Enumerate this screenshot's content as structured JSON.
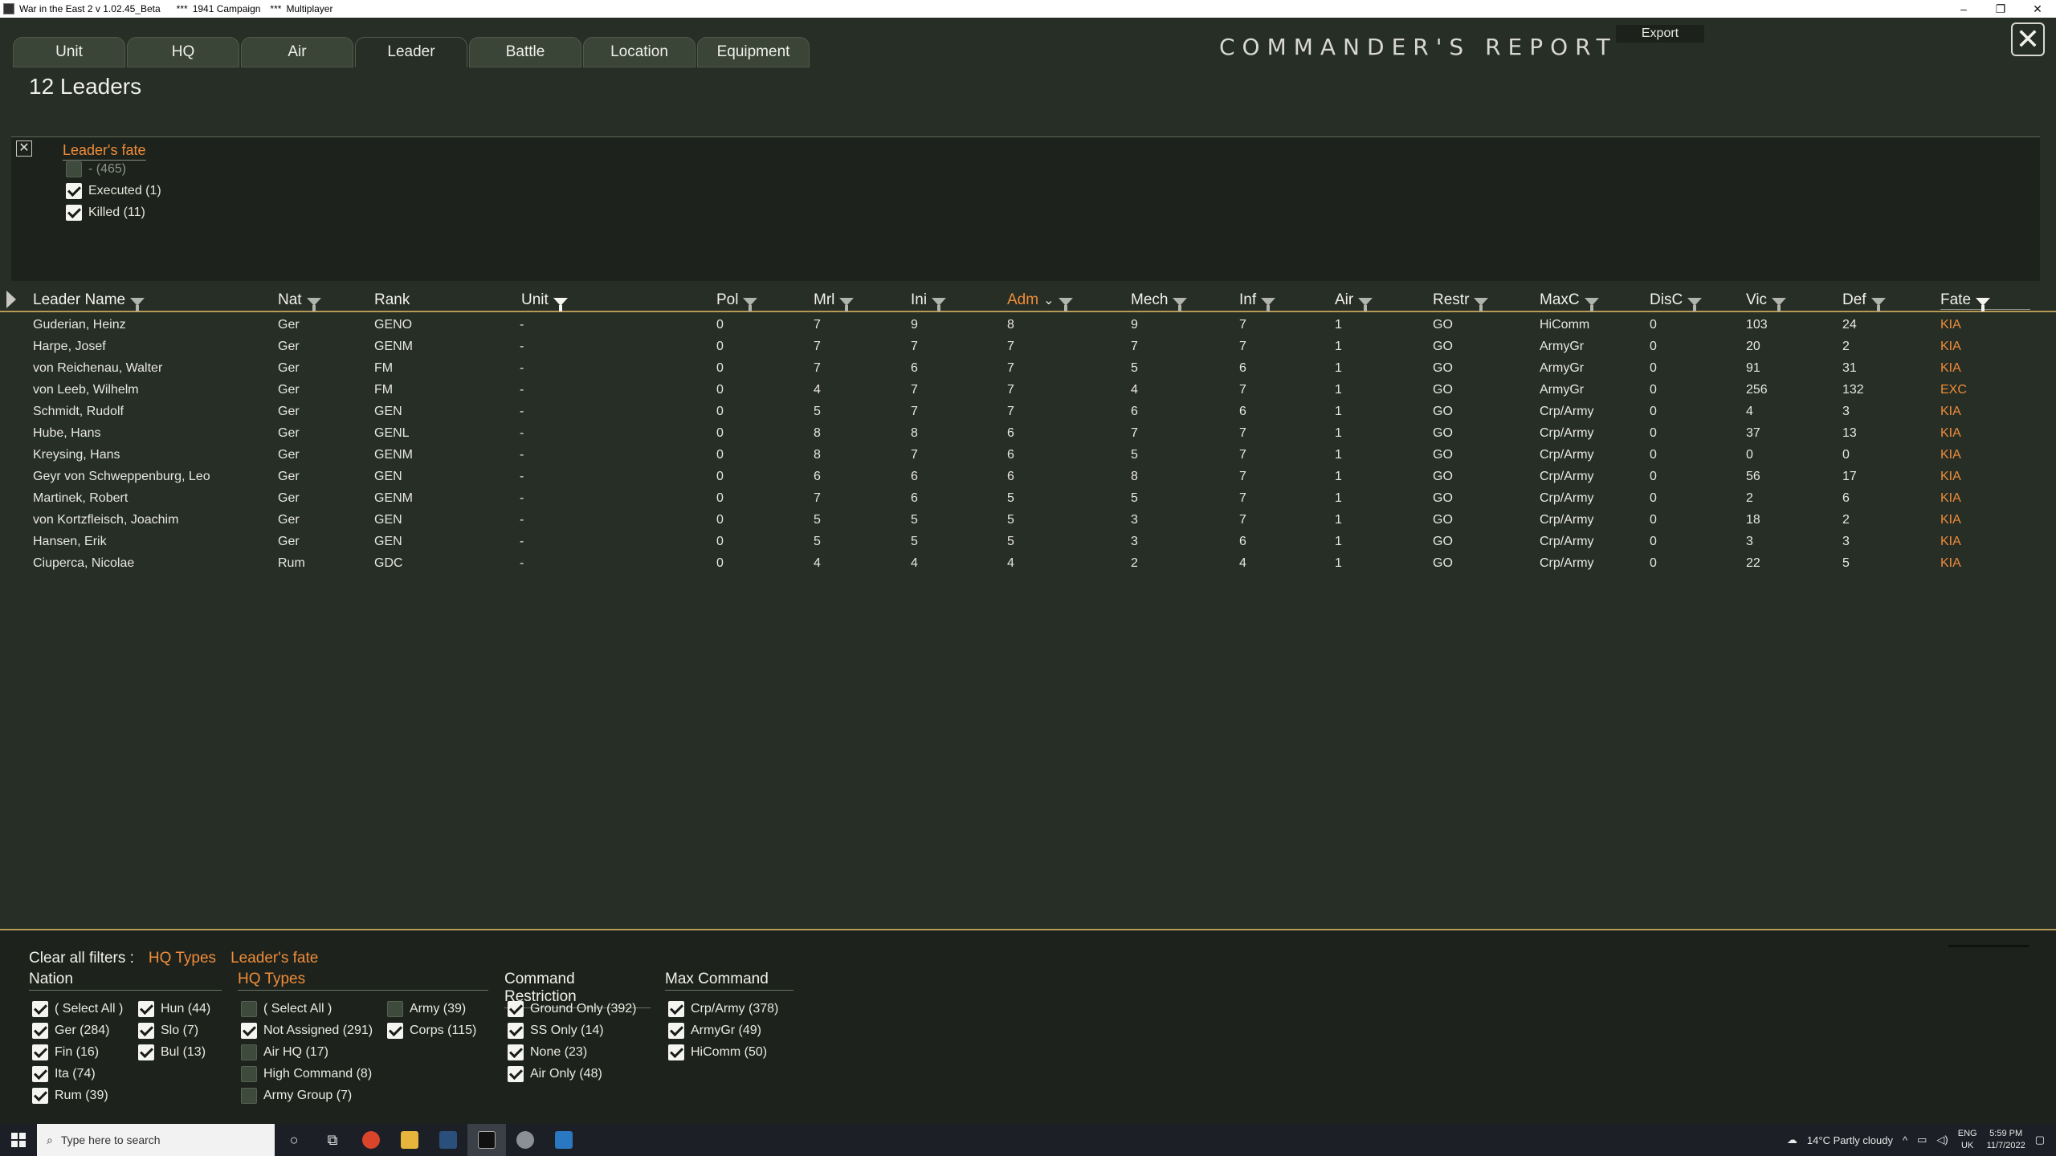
{
  "window": {
    "title": "War in the East 2  v 1.02.45_Beta",
    "sep1": "***",
    "campaign": "1941 Campaign",
    "sep2": "***",
    "mode": "Multiplayer",
    "minimize": "–",
    "restore": "❐",
    "close": "✕"
  },
  "tabs": [
    "Unit",
    "HQ",
    "Air",
    "Leader",
    "Battle",
    "Location",
    "Equipment"
  ],
  "active_tab": "Leader",
  "report_title": "COMMANDER'S   REPORT",
  "export_label": "Export",
  "close_symbol": "✕",
  "count_label": "12 Leaders",
  "fate_filter": {
    "clear_symbol": "✕",
    "title": "Leader's fate",
    "options": [
      {
        "label": "- (465)",
        "checked": false
      },
      {
        "label": "Executed (1)",
        "checked": true
      },
      {
        "label": "Killed (11)",
        "checked": true
      }
    ]
  },
  "columns": [
    "Leader Name",
    "Nat",
    "Rank",
    "Unit",
    "Pol",
    "Mrl",
    "Ini",
    "Adm",
    "Mech",
    "Inf",
    "Air",
    "Restr",
    "MaxC",
    "DisC",
    "Vic",
    "Def",
    "Fate"
  ],
  "sorted_column": "Adm",
  "rows": [
    [
      "Guderian, Heinz",
      "Ger",
      "GENO",
      "-",
      "0",
      "7",
      "9",
      "8",
      "9",
      "7",
      "1",
      "GO",
      "HiComm",
      "0",
      "103",
      "24",
      "KIA"
    ],
    [
      "Harpe, Josef",
      "Ger",
      "GENM",
      "-",
      "0",
      "7",
      "7",
      "7",
      "7",
      "7",
      "1",
      "GO",
      "ArmyGr",
      "0",
      "20",
      "2",
      "KIA"
    ],
    [
      "von Reichenau, Walter",
      "Ger",
      "FM",
      "-",
      "0",
      "7",
      "6",
      "7",
      "5",
      "6",
      "1",
      "GO",
      "ArmyGr",
      "0",
      "91",
      "31",
      "KIA"
    ],
    [
      "von Leeb, Wilhelm",
      "Ger",
      "FM",
      "-",
      "0",
      "4",
      "7",
      "7",
      "4",
      "7",
      "1",
      "GO",
      "ArmyGr",
      "0",
      "256",
      "132",
      "EXC"
    ],
    [
      "Schmidt, Rudolf",
      "Ger",
      "GEN",
      "-",
      "0",
      "5",
      "7",
      "7",
      "6",
      "6",
      "1",
      "GO",
      "Crp/Army",
      "0",
      "4",
      "3",
      "KIA"
    ],
    [
      "Hube, Hans",
      "Ger",
      "GENL",
      "-",
      "0",
      "8",
      "8",
      "6",
      "7",
      "7",
      "1",
      "GO",
      "Crp/Army",
      "0",
      "37",
      "13",
      "KIA"
    ],
    [
      "Kreysing, Hans",
      "Ger",
      "GENM",
      "-",
      "0",
      "8",
      "7",
      "6",
      "5",
      "7",
      "1",
      "GO",
      "Crp/Army",
      "0",
      "0",
      "0",
      "KIA"
    ],
    [
      "Geyr von Schweppenburg, Leo",
      "Ger",
      "GEN",
      "-",
      "0",
      "6",
      "6",
      "6",
      "8",
      "7",
      "1",
      "GO",
      "Crp/Army",
      "0",
      "56",
      "17",
      "KIA"
    ],
    [
      "Martinek, Robert",
      "Ger",
      "GENM",
      "-",
      "0",
      "7",
      "6",
      "5",
      "5",
      "7",
      "1",
      "GO",
      "Crp/Army",
      "0",
      "2",
      "6",
      "KIA"
    ],
    [
      "von Kortzfleisch, Joachim",
      "Ger",
      "GEN",
      "-",
      "0",
      "5",
      "5",
      "5",
      "3",
      "7",
      "1",
      "GO",
      "Crp/Army",
      "0",
      "18",
      "2",
      "KIA"
    ],
    [
      "Hansen, Erik",
      "Ger",
      "GEN",
      "-",
      "0",
      "5",
      "5",
      "5",
      "3",
      "6",
      "1",
      "GO",
      "Crp/Army",
      "0",
      "3",
      "3",
      "KIA"
    ],
    [
      "Ciuperca, Nicolae",
      "Rum",
      "GDC",
      "-",
      "0",
      "4",
      "4",
      "4",
      "2",
      "4",
      "1",
      "GO",
      "Crp/Army",
      "0",
      "22",
      "5",
      "KIA"
    ]
  ],
  "bottom": {
    "clear_label": "Clear all filters :",
    "active_filters": [
      "HQ Types",
      "Leader's fate"
    ],
    "nation": {
      "title": "Nation",
      "options": [
        {
          "label": "( Select All )",
          "checked": true
        },
        {
          "label": "Ger (284)",
          "checked": true
        },
        {
          "label": "Fin (16)",
          "checked": true,
          "dim": true
        },
        {
          "label": "Ita (74)",
          "checked": true,
          "dim": true
        },
        {
          "label": "Rum (39)",
          "checked": true
        },
        {
          "label": "Hun (44)",
          "checked": true,
          "dim": true
        },
        {
          "label": "Slo (7)",
          "checked": true,
          "dim": true
        },
        {
          "label": "Bul (13)",
          "checked": true,
          "dim": true
        }
      ]
    },
    "hq_types": {
      "title": "HQ Types",
      "options": [
        {
          "label": "( Select All )",
          "checked": false
        },
        {
          "label": "Not Assigned (291)",
          "checked": true
        },
        {
          "label": "Air HQ (17)",
          "checked": false,
          "dim": true
        },
        {
          "label": "High Command (8)",
          "checked": false,
          "dim": true
        },
        {
          "label": "Army Group (7)",
          "checked": false,
          "dim": true
        },
        {
          "label": "Army (39)",
          "checked": false,
          "dim": true
        },
        {
          "label": "Corps (115)",
          "checked": true,
          "dim": true
        }
      ]
    },
    "command_restriction": {
      "title": "Command Restriction",
      "options": [
        {
          "label": "Ground Only (392)",
          "checked": true
        },
        {
          "label": "SS Only (14)",
          "checked": true,
          "dim": true
        },
        {
          "label": "None (23)",
          "checked": true,
          "dim": true
        },
        {
          "label": "Air Only (48)",
          "checked": true,
          "dim": true
        }
      ]
    },
    "max_command": {
      "title": "Max Command",
      "options": [
        {
          "label": "Crp/Army (378)",
          "checked": true
        },
        {
          "label": "ArmyGr (49)",
          "checked": true
        },
        {
          "label": "HiComm (50)",
          "checked": true
        }
      ]
    }
  },
  "taskbar": {
    "search_placeholder": "Type here to search",
    "weather": "14°C  Partly cloudy",
    "lang1": "ENG",
    "lang2": "UK",
    "time": "5:59 PM",
    "date": "11/7/2022"
  },
  "colors": {
    "accent": "#f08c3a",
    "background": "#262e25",
    "panel": "#1d231c",
    "rule": "#b89a58"
  }
}
